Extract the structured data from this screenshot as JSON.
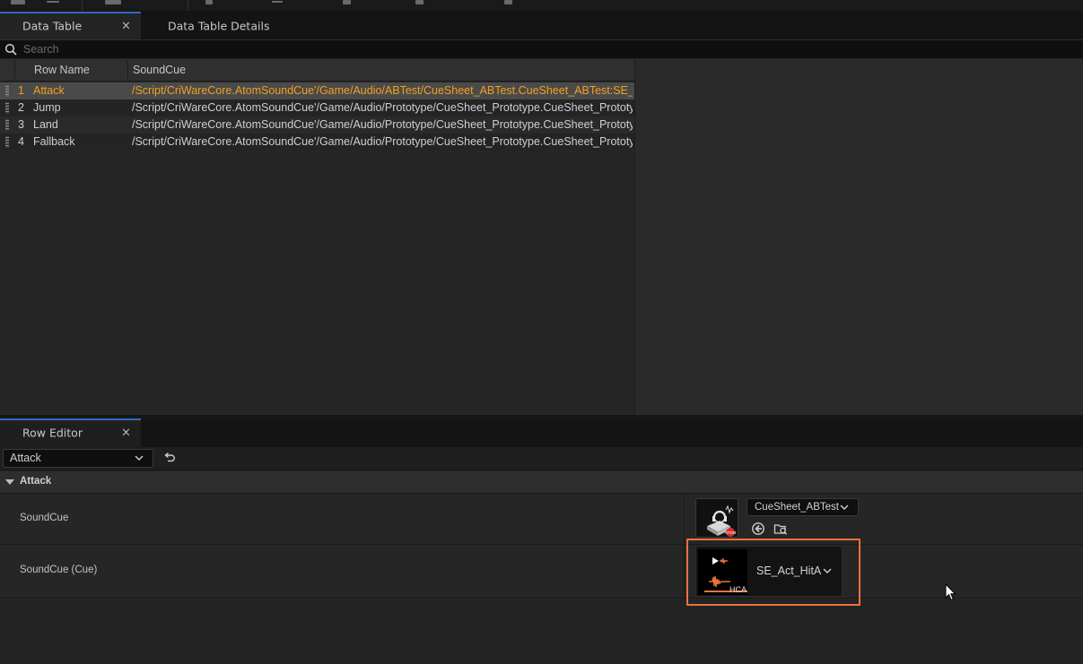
{
  "data_table_tab": {
    "label": "Data Table",
    "close": "×"
  },
  "details_tab": {
    "label": "Data Table Details"
  },
  "search": {
    "placeholder": "Search",
    "value": ""
  },
  "table": {
    "columns": [
      "Row Name",
      "SoundCue"
    ],
    "rows": [
      {
        "num": "1",
        "name": "Attack",
        "value": "/Script/CriWareCore.AtomSoundCue'/Game/Audio/ABTest/CueSheet_ABTest.CueSheet_ABTest:SE_Act_",
        "selected": true
      },
      {
        "num": "2",
        "name": "Jump",
        "value": "/Script/CriWareCore.AtomSoundCue'/Game/Audio/Prototype/CueSheet_Prototype.CueSheet_Prototype"
      },
      {
        "num": "3",
        "name": "Land",
        "value": "/Script/CriWareCore.AtomSoundCue'/Game/Audio/Prototype/CueSheet_Prototype.CueSheet_Prototype"
      },
      {
        "num": "4",
        "name": "Fallback",
        "value": "/Script/CriWareCore.AtomSoundCue'/Game/Audio/Prototype/CueSheet_Prototype.CueSheet_Prototype"
      }
    ]
  },
  "row_editor": {
    "tab_label": "Row Editor",
    "close": "×",
    "selected_row": "Attack",
    "category": "Attack",
    "properties": [
      {
        "label": "SoundCue",
        "asset": "CueSheet_ABTest"
      },
      {
        "label": "SoundCue (Cue)",
        "cue": "SE_Act_HitA",
        "cue_badge": "HCA"
      }
    ]
  },
  "colors": {
    "selected_text": "#f2a01e",
    "highlight_border": "#e8743c",
    "tab_accent": "#2d6cc0"
  }
}
